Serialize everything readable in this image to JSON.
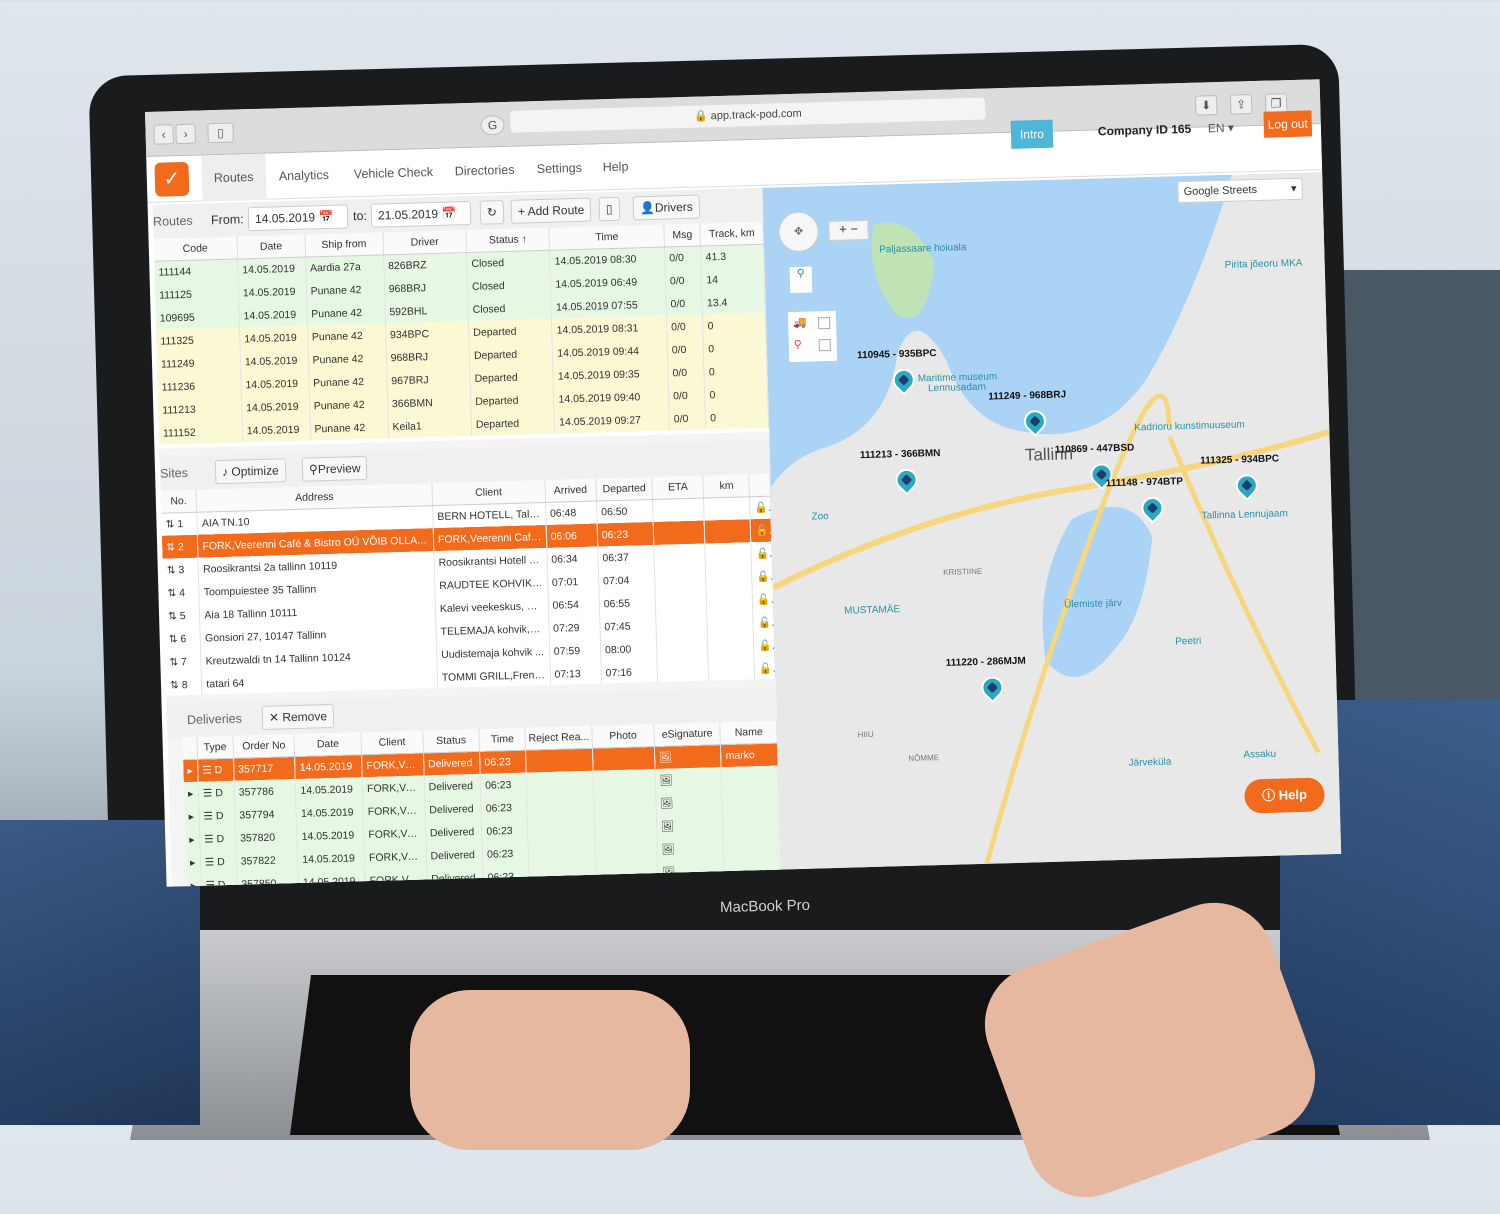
{
  "browser": {
    "url": "app.track-pod.com"
  },
  "nav": {
    "items": [
      "Routes",
      "Analytics",
      "Vehicle Check",
      "Directories",
      "Settings",
      "Help"
    ],
    "intro": "Intro",
    "company": "Company ID 165",
    "lang": "EN",
    "logout": "Log out"
  },
  "routes": {
    "title": "Routes",
    "from_label": "From:",
    "from": "14.05.2019",
    "to_label": "to:",
    "to": "21.05.2019",
    "add_route": "+ Add Route",
    "drivers": "Drivers",
    "columns": [
      "Code",
      "Date",
      "Ship from",
      "Driver",
      "Status ↑",
      "Time",
      "Msg",
      "Track, km"
    ],
    "rows": [
      [
        "111144",
        "14.05.2019",
        "Aardia 27a",
        "826BRZ",
        "Closed",
        "14.05.2019 08:30",
        "0/0",
        "41.3"
      ],
      [
        "111125",
        "14.05.2019",
        "Punane 42",
        "968BRJ",
        "Closed",
        "14.05.2019 06:49",
        "0/0",
        "14"
      ],
      [
        "109695",
        "14.05.2019",
        "Punane 42",
        "592BHL",
        "Closed",
        "14.05.2019 07:55",
        "0/0",
        "13.4"
      ],
      [
        "111325",
        "14.05.2019",
        "Punane 42",
        "934BPC",
        "Departed",
        "14.05.2019 08:31",
        "0/0",
        "0"
      ],
      [
        "111249",
        "14.05.2019",
        "Punane 42",
        "968BRJ",
        "Departed",
        "14.05.2019 09:44",
        "0/0",
        "0"
      ],
      [
        "111236",
        "14.05.2019",
        "Punane 42",
        "967BRJ",
        "Departed",
        "14.05.2019 09:35",
        "0/0",
        "0"
      ],
      [
        "111213",
        "14.05.2019",
        "Punane 42",
        "366BMN",
        "Departed",
        "14.05.2019 09:40",
        "0/0",
        "0"
      ],
      [
        "111152",
        "14.05.2019",
        "Punane 42",
        "Keila1",
        "Departed",
        "14.05.2019 09:27",
        "0/0",
        "0"
      ]
    ]
  },
  "sites": {
    "title": "Sites",
    "optimize": "Optimize",
    "preview": "Preview",
    "columns": [
      "No.",
      "Address",
      "Client",
      "Arrived",
      "Departed",
      "ETA",
      "km",
      ""
    ],
    "rows": [
      [
        "1",
        "AIA TN.10",
        "BERN HOTELL, Tallin...",
        "06:48",
        "06:50",
        "",
        ""
      ],
      [
        "2",
        "FORK,Veerenni Café & Bistro OÜ VÕIB OLLA VA...",
        "FORK,Veerenni Café ...",
        "06:06",
        "06:23",
        "",
        ""
      ],
      [
        "3",
        "Roosikrantsi 2a tallinn 10119",
        "Roosikrantsi Hotell OÜ",
        "06:34",
        "06:37",
        "",
        ""
      ],
      [
        "4",
        "Toompuiestee 35 Tallinn",
        "RAUDTEE KOHVIK OÜ",
        "07:01",
        "07:04",
        "",
        ""
      ],
      [
        "5",
        "Aia 18 Tallinn 10111",
        "Kalevi veekeskus, KA...",
        "06:54",
        "06:55",
        "",
        ""
      ],
      [
        "6",
        "Gonsiori 27, 10147 Tallinn",
        "TELEMAJA kohvik,AV...",
        "07:29",
        "07:45",
        "",
        ""
      ],
      [
        "7",
        "Kreutzwaldi tn 14 Tallinn 10124",
        "Uudistemaja kohvik ...",
        "07:59",
        "08:00",
        "",
        ""
      ],
      [
        "8",
        "tatari 64",
        "TOMMI GRILL,Frendo...",
        "07:13",
        "07:16",
        "",
        ""
      ]
    ]
  },
  "deliveries": {
    "title": "Deliveries",
    "remove": "Remove",
    "columns": [
      "",
      "Type",
      "Order No",
      "Date",
      "Client",
      "Status",
      "Time",
      "Reject Rea...",
      "Photo",
      "eSignature",
      "Name"
    ],
    "rows": [
      [
        "D",
        "357717",
        "14.05.2019",
        "FORK,Veer...",
        "Delivered",
        "06:23",
        "",
        "",
        "",
        "marko"
      ],
      [
        "D",
        "357786",
        "14.05.2019",
        "FORK,Veer...",
        "Delivered",
        "06:23",
        "",
        "",
        "",
        ""
      ],
      [
        "D",
        "357794",
        "14.05.2019",
        "FORK,Veer...",
        "Delivered",
        "06:23",
        "",
        "",
        "",
        ""
      ],
      [
        "D",
        "357820",
        "14.05.2019",
        "FORK,Veer...",
        "Delivered",
        "06:23",
        "",
        "",
        "",
        ""
      ],
      [
        "D",
        "357822",
        "14.05.2019",
        "FORK,Veer...",
        "Delivered",
        "06:23",
        "",
        "",
        "",
        ""
      ],
      [
        "D",
        "357850",
        "14.05.2019",
        "FORK,Veer...",
        "Delivered",
        "06:23",
        "",
        "",
        "",
        ""
      ]
    ]
  },
  "map": {
    "layer": "Google Streets",
    "help": "Help",
    "vehicles": [
      "110945 - 935BPC",
      "111249 - 968BRJ",
      "110869 - 447BSD",
      "111213 - 366BMN",
      "111148 - 974BTP",
      "111325 - 934BPC",
      "111220 - 286MJM"
    ],
    "places": [
      "Paljassaare hoiuala",
      "Maritime museum",
      "Lennusadam",
      "Kadrioru kunstimuuseum",
      "Tallinn",
      "Pirita jõeoru MKA",
      "Zoo",
      "Tallinna Lennujaam",
      "Ülemiste järv",
      "Peetri",
      "Järveküla",
      "Assaku",
      "NÕMME",
      "MUSTAMÄE",
      "KRISTIINE",
      "HIIU"
    ]
  },
  "device": {
    "brand": "MacBook Pro"
  },
  "colors": {
    "accent": "#f26b1d",
    "closed_row": "#e6f7e3",
    "departed_row": "#fbf8d4",
    "marker": "#2aa9c0",
    "intro": "#4fb6d8"
  }
}
